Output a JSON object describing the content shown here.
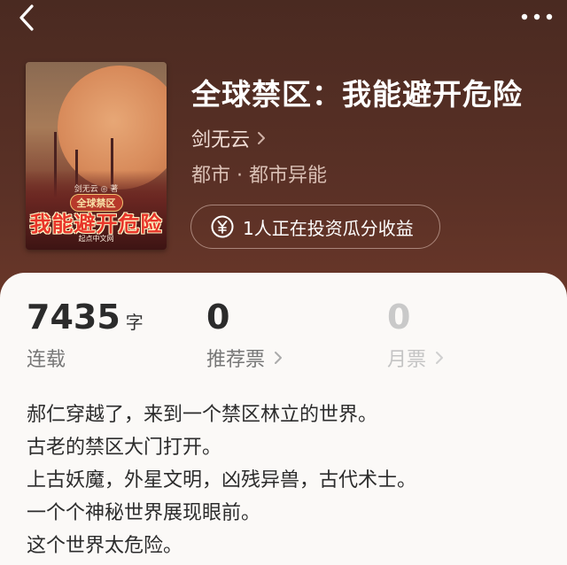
{
  "header": {
    "back_icon": "chevron-left-icon",
    "more_icon": "more-horizontal-icon"
  },
  "book": {
    "title": "全球禁区：我能避开危险",
    "author": "剑无云",
    "category": "都市 · 都市异能",
    "cover": {
      "author_line": "剑无云 ◎ 著",
      "subtitle": "全球禁区",
      "main_title": "我能避开危险",
      "publisher": "起点中文网"
    }
  },
  "invest": {
    "icon": "yen-circle-icon",
    "text": "1人正在投资瓜分收益"
  },
  "stats": {
    "words": {
      "value": "7435",
      "unit": "字",
      "label": "连载"
    },
    "recommend": {
      "value": "0",
      "label": "推荐票"
    },
    "monthly": {
      "value": "0",
      "label": "月票"
    }
  },
  "intro": {
    "lines": [
      "郝仁穿越了，来到一个禁区林立的世界。",
      "古老的禁区大门打开。",
      "上古妖魔，外星文明，凶残异兽，古代术士。",
      "一个个神秘世界展现眼前。",
      "这个世界太危险。"
    ]
  },
  "colors": {
    "header_bg": "#5b3126",
    "card_bg": "#fbf9f7",
    "title_text": "#ffffff"
  }
}
